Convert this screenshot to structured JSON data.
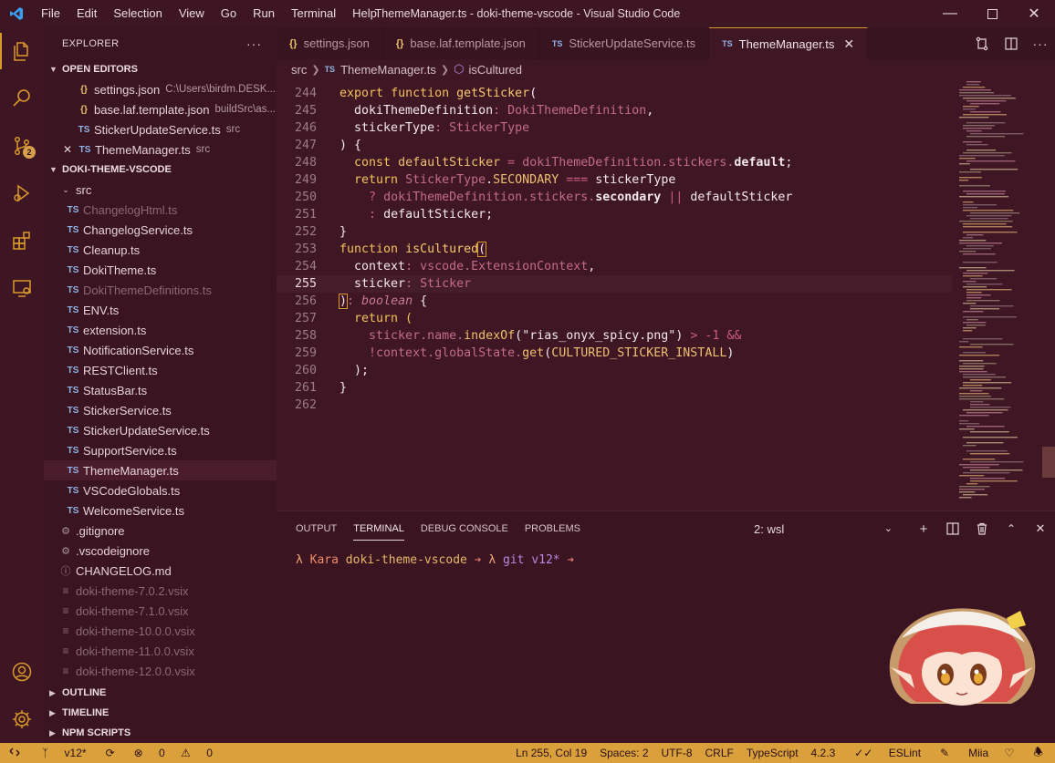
{
  "titlebar": {
    "menu": [
      "File",
      "Edit",
      "Selection",
      "View",
      "Go",
      "Run",
      "Terminal",
      "Help"
    ],
    "title": "ThemeManager.ts - doki-theme-vscode - Visual Studio Code"
  },
  "activity": {
    "scm_badge": "2"
  },
  "sidebar": {
    "header": "EXPLORER",
    "open_editors": {
      "title": "OPEN EDITORS",
      "items": [
        {
          "name": "settings.json",
          "desc": "C:\\Users\\birdm.DESK..."
        },
        {
          "name": "base.laf.template.json",
          "desc": "buildSrc\\as..."
        },
        {
          "name": "StickerUpdateService.ts",
          "desc": "src"
        },
        {
          "name": "ThemeManager.ts",
          "desc": "src"
        }
      ]
    },
    "project": {
      "title": "DOKI-THEME-VSCODE",
      "folder": "src",
      "files": [
        "ChangelogHtml.ts",
        "ChangelogService.ts",
        "Cleanup.ts",
        "DokiTheme.ts",
        "DokiThemeDefinitions.ts",
        "ENV.ts",
        "extension.ts",
        "NotificationService.ts",
        "RESTClient.ts",
        "StatusBar.ts",
        "StickerService.ts",
        "StickerUpdateService.ts",
        "SupportService.ts",
        "ThemeManager.ts",
        "VSCodeGlobals.ts",
        "WelcomeService.ts"
      ],
      "root_files": [
        ".gitignore",
        ".vscodeignore",
        "CHANGELOG.md"
      ],
      "vsix_files": [
        "doki-theme-7.0.2.vsix",
        "doki-theme-7.1.0.vsix",
        "doki-theme-10.0.0.vsix",
        "doki-theme-11.0.0.vsix",
        "doki-theme-12.0.0.vsix"
      ]
    },
    "outline": "OUTLINE",
    "timeline": "TIMELINE",
    "npm_scripts": "NPM SCRIPTS"
  },
  "editor": {
    "tabs": [
      {
        "label": "settings.json",
        "icon": "{}"
      },
      {
        "label": "base.laf.template.json",
        "icon": "{}"
      },
      {
        "label": "StickerUpdateService.ts",
        "icon": "TS"
      },
      {
        "label": "ThemeManager.ts",
        "icon": "TS"
      }
    ],
    "breadcrumb": {
      "folder": "src",
      "file": "ThemeManager.ts",
      "symbol": "isCultured"
    },
    "line_numbers": [
      "244",
      "245",
      "246",
      "247",
      "248",
      "249",
      "250",
      "251",
      "252",
      "253",
      "254",
      "255",
      "256",
      "257",
      "258",
      "259",
      "260",
      "261",
      "262"
    ],
    "code": {
      "l244a": "export",
      "l244b": "function",
      "l244c": "getSticker",
      "l244d": "(",
      "l245a": "dokiThemeDefinition",
      "l245b": ":",
      "l245c": "DokiThemeDefinition",
      "l245d": ",",
      "l246a": "stickerType",
      "l246b": ":",
      "l246c": "StickerType",
      "l247": ") {",
      "l248a": "const",
      "l248b": "defaultSticker",
      "l248c": "=",
      "l248d": "dokiThemeDefinition",
      "l248e": ".stickers.",
      "l248f": "default",
      "l248g": ";",
      "l249a": "return",
      "l249b": "StickerType",
      "l249c": ".",
      "l249d": "SECONDARY",
      "l249e": "===",
      "l249f": "stickerType",
      "l250a": "?",
      "l250b": "dokiThemeDefinition",
      "l250c": ".stickers.",
      "l250d": "secondary",
      "l250e": "||",
      "l250f": "defaultSticker",
      "l251a": ":",
      "l251b": "defaultSticker;",
      "l252": "}",
      "l253a": "function",
      "l253b": "isCultured",
      "l253c": "(",
      "l254a": "context",
      "l254b": ":",
      "l254c": "vscode.ExtensionContext",
      "l254d": ",",
      "l255a": "sticker",
      "l255b": ":",
      "l255c": "Sticker",
      "l256a": ")",
      "l256b": ":",
      "l256c": "boolean",
      "l256d": "{",
      "l257": "return (",
      "l258a": "sticker",
      "l258b": ".name.",
      "l258c": "indexOf",
      "l258d": "(",
      "l258e": "\"rias_onyx_spicy.png\"",
      "l258f": ")",
      "l258g": ">",
      "l258h": "-1",
      "l258i": "&&",
      "l259a": "!context",
      "l259b": ".globalState.",
      "l259c": "get",
      "l259d": "(",
      "l259e": "CULTURED_STICKER_INSTALL",
      "l259f": ")",
      "l260": ");",
      "l261": "}"
    }
  },
  "panel": {
    "tabs": [
      "OUTPUT",
      "TERMINAL",
      "DEBUG CONSOLE",
      "PROBLEMS"
    ],
    "terminal_select": "2: wsl",
    "prompt": {
      "lambda": "λ",
      "user": "Kara",
      "dir": "doki-theme-vscode",
      "arrow": "➔",
      "lambda2": "λ",
      "git": "git",
      "branch": "v12*",
      "arrow2": "➔"
    }
  },
  "statusbar": {
    "branch": "v12*",
    "errors": "0",
    "warnings": "0",
    "position": "Ln 255, Col 19",
    "spaces": "Spaces: 2",
    "encoding": "UTF-8",
    "eol": "CRLF",
    "language": "TypeScript",
    "version": "4.2.3",
    "eslint": "ESLint",
    "theme": "Miia"
  },
  "colors": {
    "accent": "#d99a2b",
    "background": "#3f1624",
    "statusbar": "#d9a03c"
  }
}
